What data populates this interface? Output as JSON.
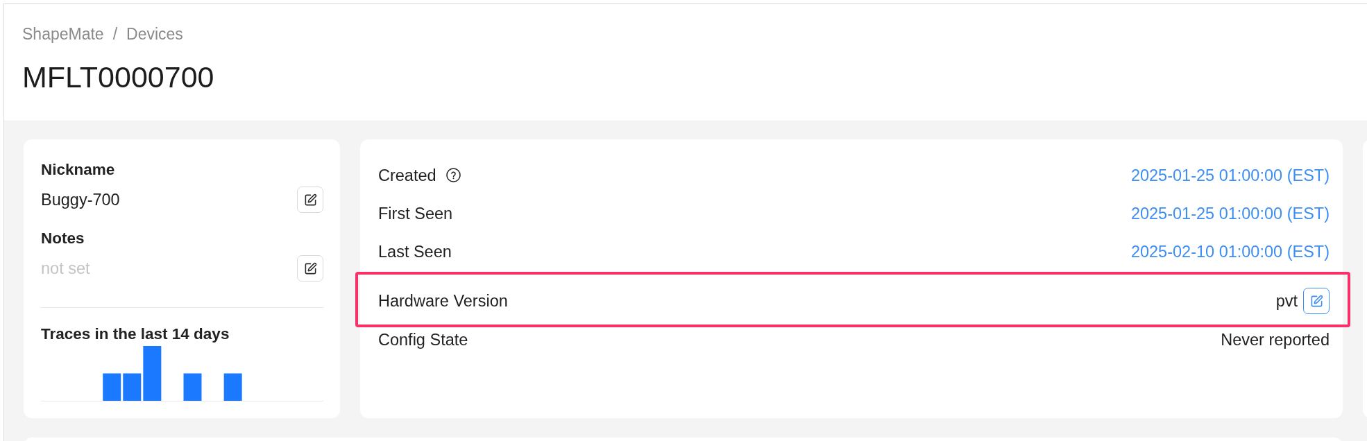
{
  "breadcrumb": {
    "items": [
      "ShapeMate",
      "Devices"
    ],
    "separator": "/"
  },
  "title": "MFLT0000700",
  "properties": {
    "fields": [
      {
        "label": "Nickname",
        "value": "Buggy-700",
        "empty": false,
        "edit_focused": false
      },
      {
        "label": "Notes",
        "value": "not set",
        "empty": true,
        "edit_focused": false
      }
    ],
    "traces": {
      "title": "Traces in the last 14 days"
    }
  },
  "details": {
    "rows": [
      {
        "kind": "timestamp",
        "label": "Created",
        "value": "2025-01-25 01:00:00 (EST)",
        "help": true,
        "highlighted": false
      },
      {
        "kind": "timestamp",
        "label": "First Seen",
        "value": "2025-01-25 01:00:00 (EST)",
        "help": false,
        "highlighted": false
      },
      {
        "kind": "timestamp",
        "label": "Last Seen",
        "value": "2025-02-10 01:00:00 (EST)",
        "help": false,
        "highlighted": false
      },
      {
        "kind": "editable",
        "label": "Hardware Version",
        "value": "pvt",
        "help": false,
        "highlighted": true,
        "edit_focused": true
      },
      {
        "kind": "text",
        "label": "Config State",
        "value": "Never reported",
        "help": false,
        "highlighted": false
      }
    ]
  }
}
